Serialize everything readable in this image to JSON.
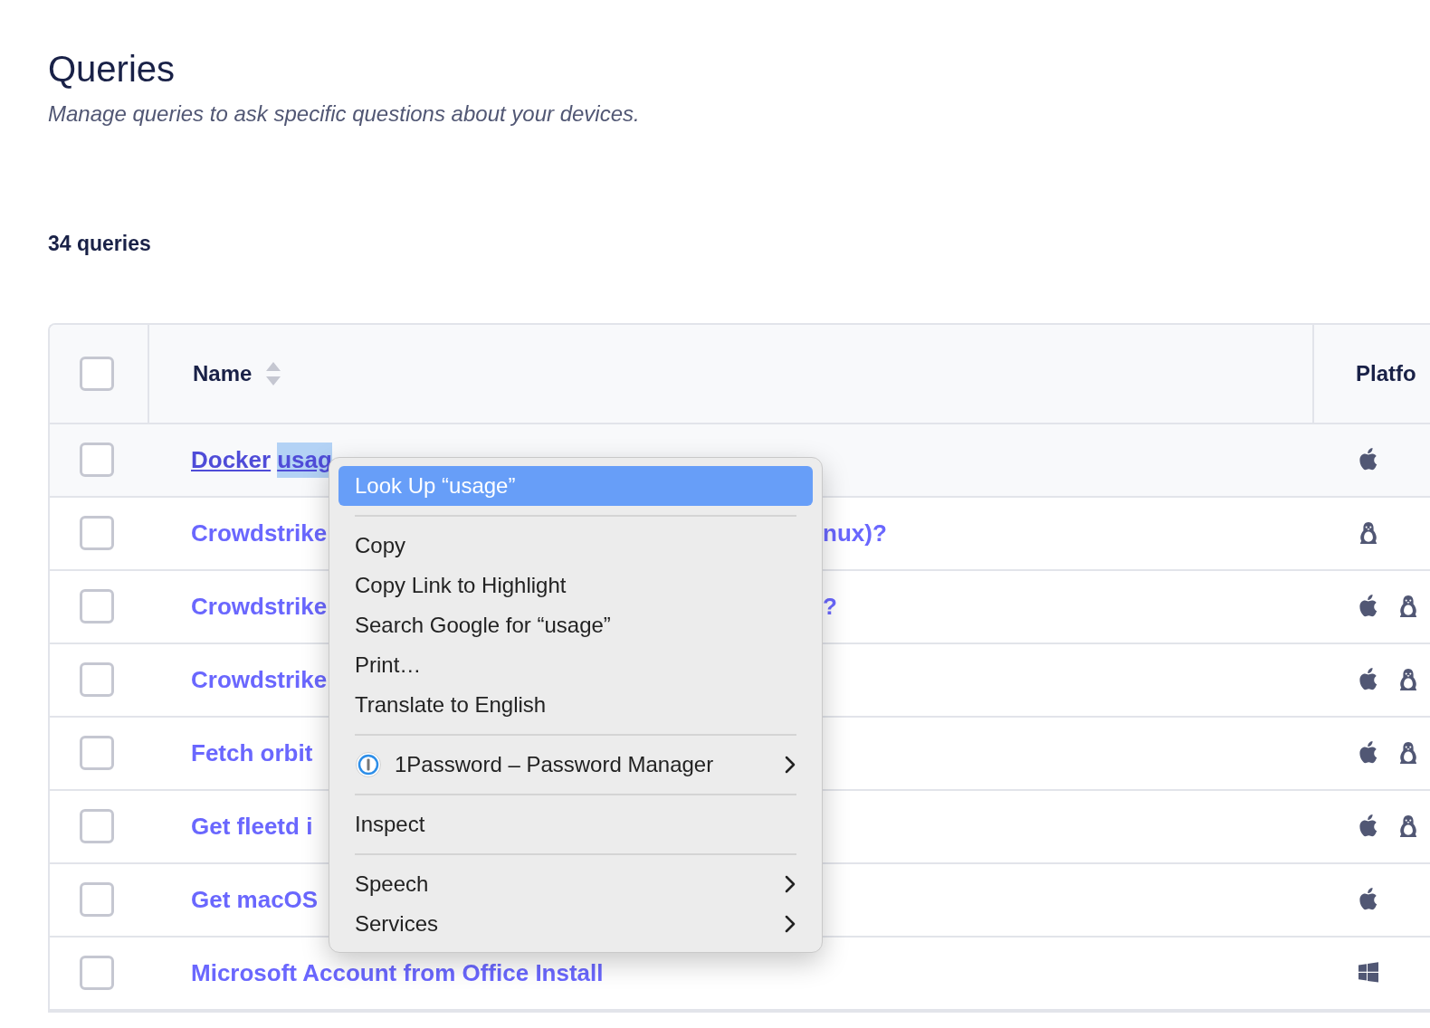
{
  "header": {
    "title": "Queries",
    "subtitle": "Manage queries to ask specific questions about your devices."
  },
  "count": "34 queries",
  "table": {
    "columns": [
      {
        "label": "Name",
        "sortable": true
      },
      {
        "label": "Platfo",
        "sortable": false
      }
    ],
    "header_checked": false,
    "rows": [
      {
        "name": "Docker",
        "highlighted": "usag",
        "name_right": "",
        "hovered": true,
        "checked": false,
        "platforms": [
          {
            "kind": "apple"
          }
        ]
      },
      {
        "name": "Crowdstrike",
        "highlighted": "",
        "name_right": "nux)?",
        "hovered": false,
        "checked": false,
        "platforms": [
          {
            "kind": "linux"
          }
        ]
      },
      {
        "name": "Crowdstrike",
        "highlighted": "",
        "name_right": "?",
        "hovered": false,
        "checked": false,
        "platforms": [
          {
            "kind": "apple"
          },
          {
            "kind": "linux"
          }
        ]
      },
      {
        "name": "Crowdstrike",
        "highlighted": "",
        "name_right": "",
        "hovered": false,
        "checked": false,
        "platforms": [
          {
            "kind": "apple"
          },
          {
            "kind": "linux"
          }
        ]
      },
      {
        "name": "Fetch orbit",
        "highlighted": "",
        "name_right": "",
        "hovered": false,
        "checked": false,
        "platforms": [
          {
            "kind": "apple"
          },
          {
            "kind": "linux"
          }
        ]
      },
      {
        "name": "Get fleetd i",
        "highlighted": "",
        "name_right": "",
        "hovered": false,
        "checked": false,
        "platforms": [
          {
            "kind": "apple"
          },
          {
            "kind": "linux"
          }
        ]
      },
      {
        "name": "Get macOS",
        "highlighted": "",
        "name_right": "",
        "hovered": false,
        "checked": false,
        "platforms": [
          {
            "kind": "apple"
          }
        ]
      },
      {
        "name": "Microsoft Account from Office Install",
        "highlighted": "",
        "name_right": "",
        "hovered": false,
        "checked": false,
        "platforms": [
          {
            "kind": "windows"
          }
        ]
      }
    ]
  },
  "context_menu": {
    "items": [
      {
        "kind": "item",
        "label": "Look Up “usage”",
        "selected": true
      },
      {
        "kind": "separator"
      },
      {
        "kind": "item",
        "label": "Copy",
        "selected": false
      },
      {
        "kind": "item",
        "label": "Copy Link to Highlight",
        "selected": false
      },
      {
        "kind": "item",
        "label": "Search Google for “usage”",
        "selected": false
      },
      {
        "kind": "item",
        "label": "Print…",
        "selected": false
      },
      {
        "kind": "item",
        "label": "Translate to English",
        "selected": false
      },
      {
        "kind": "separator"
      },
      {
        "kind": "app_submenu",
        "label": "1Password – Password Manager",
        "selected": false
      },
      {
        "kind": "separator"
      },
      {
        "kind": "item",
        "label": "Inspect",
        "selected": false
      },
      {
        "kind": "separator"
      },
      {
        "kind": "submenu",
        "label": "Speech",
        "selected": false
      },
      {
        "kind": "submenu",
        "label": "Services",
        "selected": false
      }
    ]
  }
}
